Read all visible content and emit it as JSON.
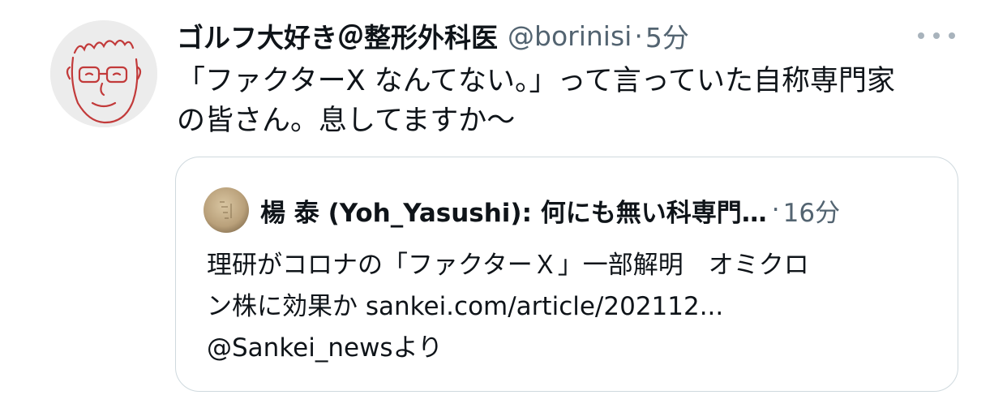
{
  "tweet": {
    "display_name": "ゴルフ大好き＠整形外科医",
    "handle": "@borinisi",
    "separator": "·",
    "time": "5分",
    "avatar_icon": "hand-drawn-face-avatar",
    "more_icon": "more-options-icon",
    "text_lines": [
      "「ファクターX なんてない。」って言っていた自称専門家",
      "の皆さん。息してますか〜"
    ]
  },
  "quoted": {
    "avatar_icon": "pill-photo-avatar",
    "name": "楊 泰 (Yoh_Yasushi): 何にも無い科専門…",
    "separator": "·",
    "time": "16分",
    "text_lines": [
      "理研がコロナの「ファクターＸ」一部解明　オミクロ",
      "ン株に効果か sankei.com/article/202112...",
      "@Sankei_newsより"
    ]
  },
  "colors": {
    "text_primary": "#0f1419",
    "text_secondary": "#536471",
    "border": "#cfd9de",
    "avatar_sketch": "#c23a3a"
  }
}
